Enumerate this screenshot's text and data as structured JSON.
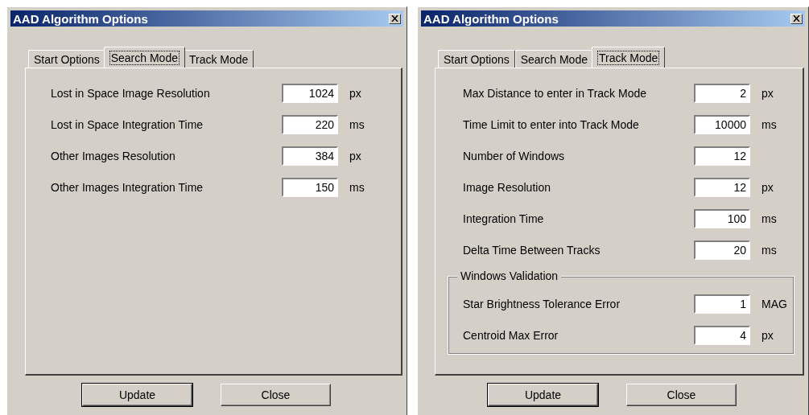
{
  "windows": [
    {
      "title": "AAD Algorithm Options",
      "tabs": [
        {
          "label": "Start Options",
          "selected": false
        },
        {
          "label": "Search Mode",
          "selected": true
        },
        {
          "label": "Track Mode",
          "selected": false
        }
      ],
      "fields": [
        {
          "label": "Lost in Space Image Resolution",
          "value": "1024",
          "unit": "px"
        },
        {
          "label": "Lost in Space Integration Time",
          "value": "220",
          "unit": "ms"
        },
        {
          "label": "Other Images Resolution",
          "value": "384",
          "unit": "px"
        },
        {
          "label": "Other Images Integration Time",
          "value": "150",
          "unit": "ms"
        }
      ],
      "buttons": [
        {
          "label": "Update",
          "default": true
        },
        {
          "label": "Close",
          "default": false
        }
      ]
    },
    {
      "title": "AAD Algorithm Options",
      "tabs": [
        {
          "label": "Start Options",
          "selected": false
        },
        {
          "label": "Search Mode",
          "selected": false
        },
        {
          "label": "Track Mode",
          "selected": true
        }
      ],
      "fields": [
        {
          "label": "Max Distance to enter in Track Mode",
          "value": "2",
          "unit": "px"
        },
        {
          "label": "Time Limit to enter into Track Mode",
          "value": "10000",
          "unit": "ms"
        },
        {
          "label": "Number of Windows",
          "value": "12"
        },
        {
          "label": "Image Resolution",
          "value": "12",
          "unit": "px"
        },
        {
          "label": "Integration Time",
          "value": "100",
          "unit": "ms"
        },
        {
          "label": "Delta Time Between Tracks",
          "value": "20",
          "unit": "ms"
        }
      ],
      "group": {
        "title": "Windows Validation",
        "fields": [
          {
            "label": "Star Brightness Tolerance Error",
            "value": "1",
            "unit": "MAG"
          },
          {
            "label": "Centroid Max Error",
            "value": "4",
            "unit": "px"
          }
        ]
      },
      "buttons": [
        {
          "label": "Update",
          "default": true
        },
        {
          "label": "Close",
          "default": false
        }
      ]
    }
  ]
}
